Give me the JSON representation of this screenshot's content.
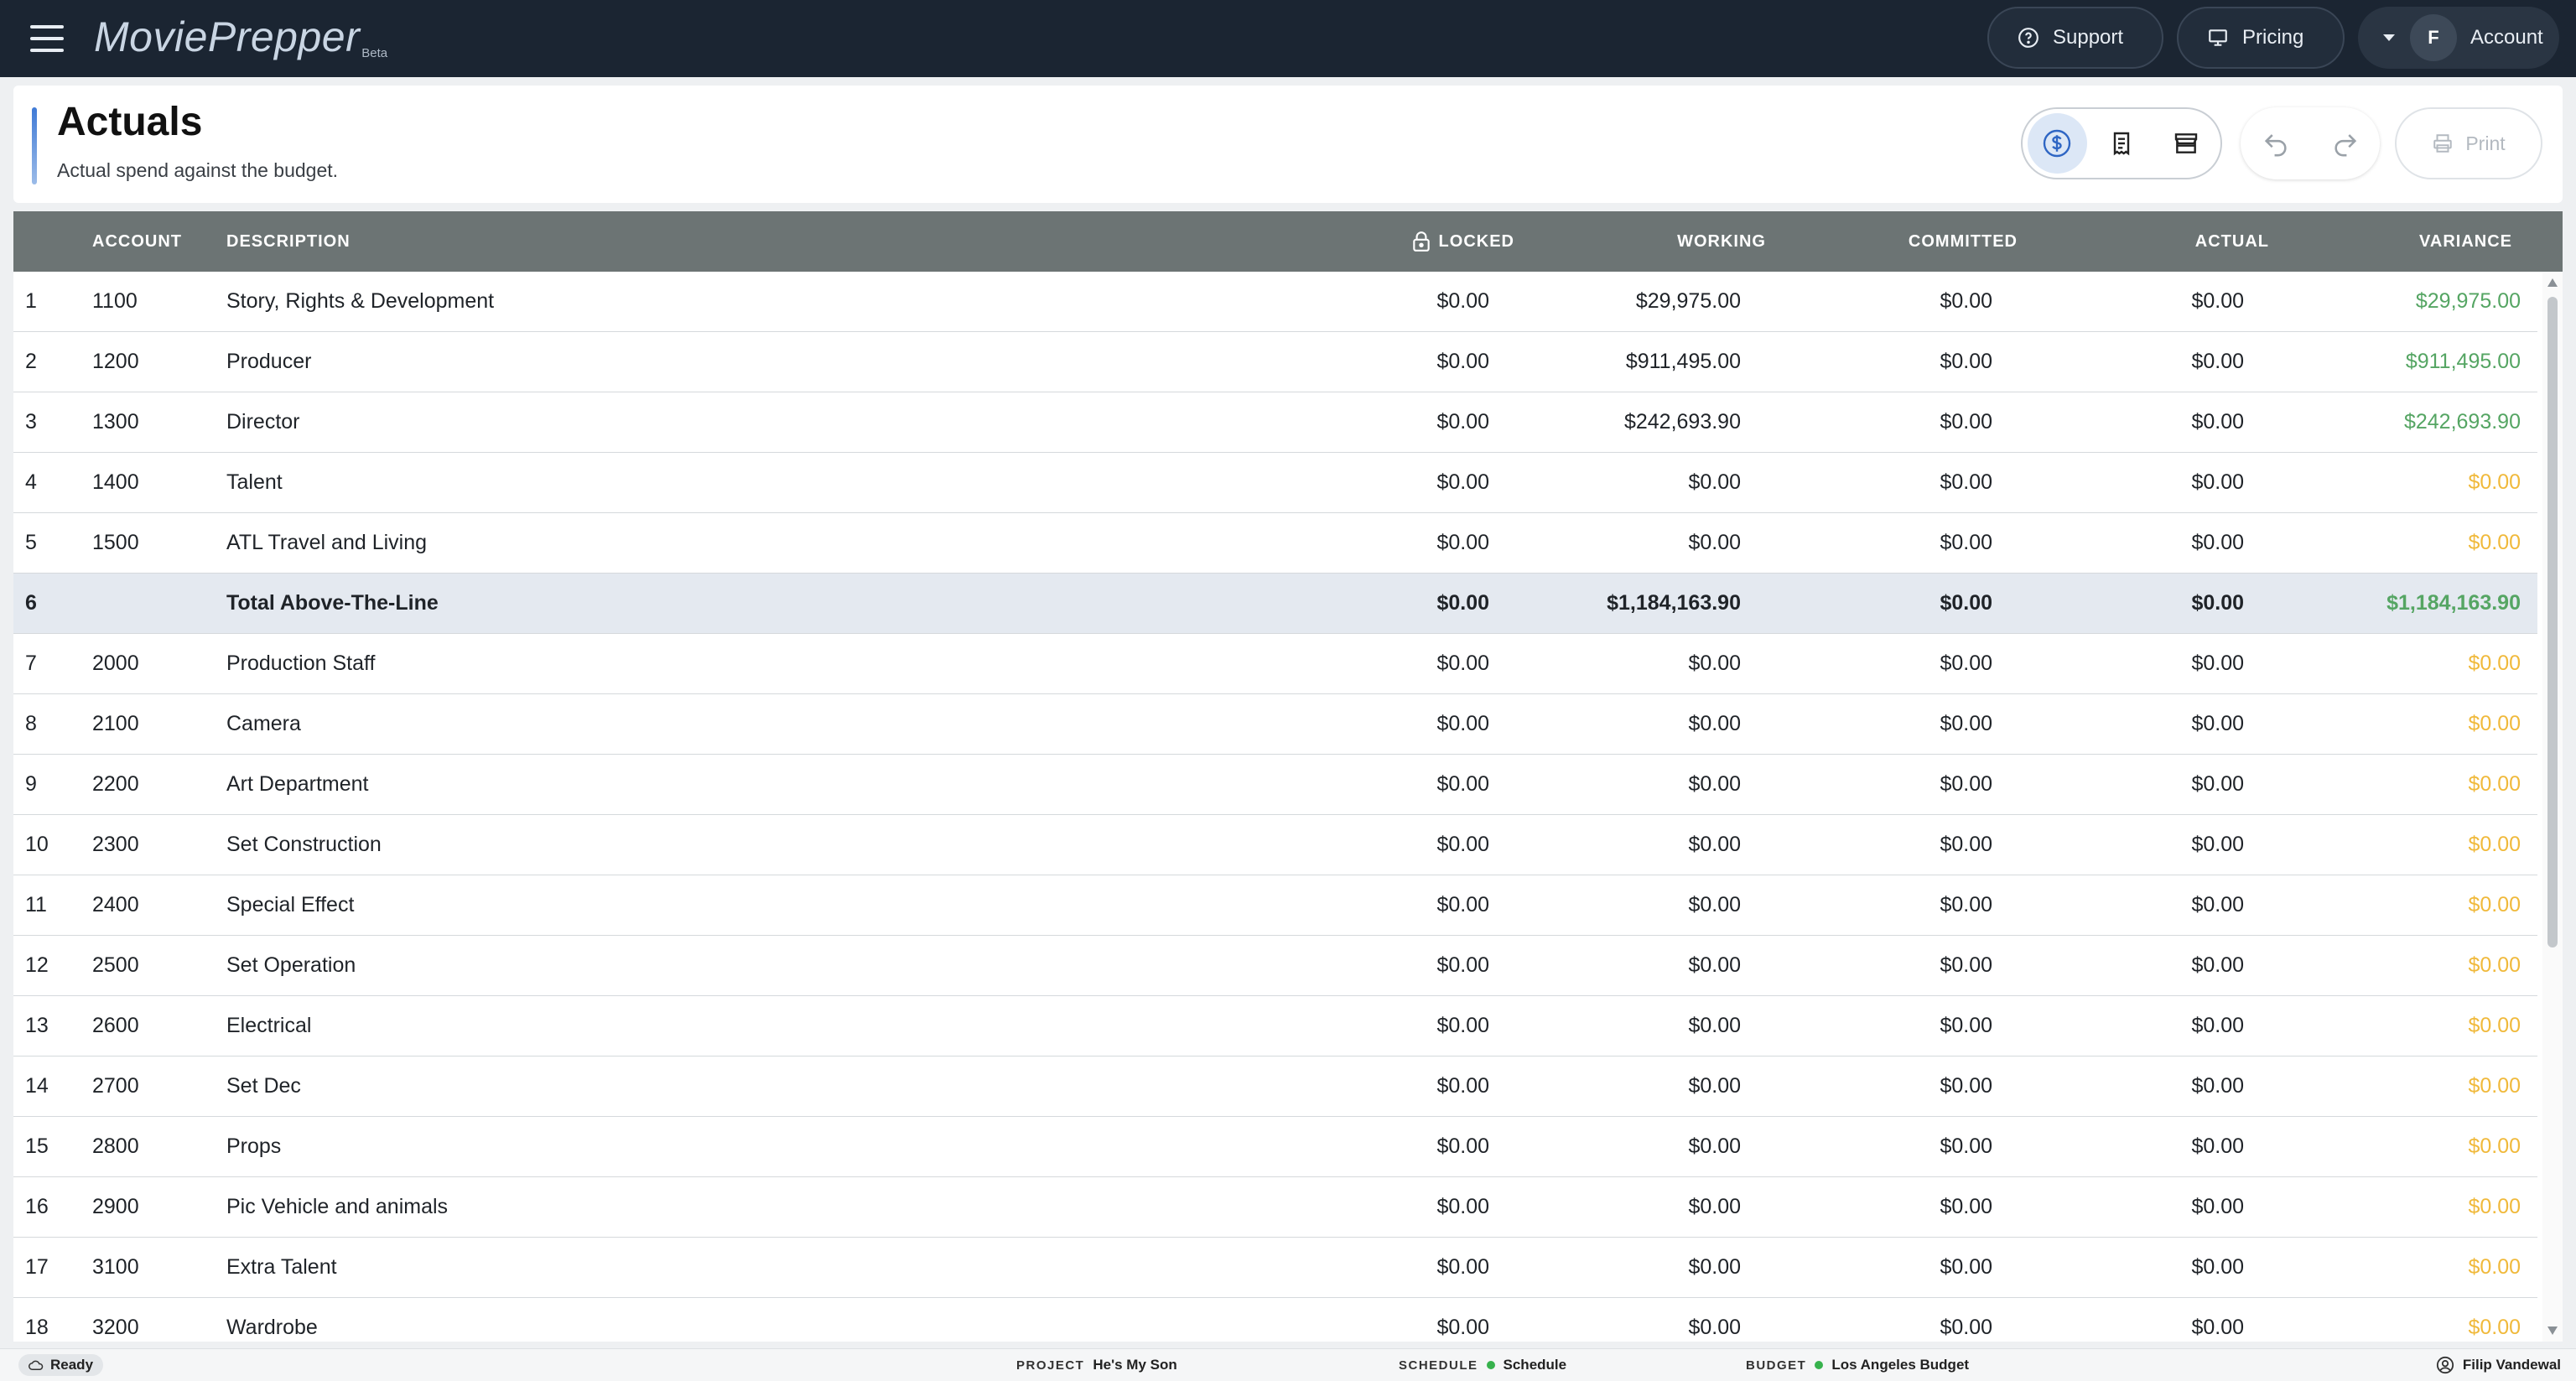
{
  "topbar": {
    "logo_text": "MoviePrepper",
    "logo_badge": "Beta",
    "support_label": "Support",
    "pricing_label": "Pricing",
    "account_initial": "F",
    "account_label": "Account"
  },
  "header": {
    "title": "Actuals",
    "subtitle": "Actual spend against the budget.",
    "print_label": "Print",
    "active_view": "dollar-icon"
  },
  "table": {
    "columns": {
      "account": "ACCOUNT",
      "description": "DESCRIPTION",
      "locked": "LOCKED",
      "working": "WORKING",
      "committed": "COMMITTED",
      "actual": "ACTUAL",
      "variance": "VARIANCE"
    },
    "rows": [
      {
        "num": "1",
        "account": "1100",
        "description": "Story, Rights & Development",
        "locked": "$0.00",
        "working": "$29,975.00",
        "committed": "$0.00",
        "actual": "$0.00",
        "variance": "$29,975.00",
        "variance_state": "positive"
      },
      {
        "num": "2",
        "account": "1200",
        "description": "Producer",
        "locked": "$0.00",
        "working": "$911,495.00",
        "committed": "$0.00",
        "actual": "$0.00",
        "variance": "$911,495.00",
        "variance_state": "positive"
      },
      {
        "num": "3",
        "account": "1300",
        "description": "Director",
        "locked": "$0.00",
        "working": "$242,693.90",
        "committed": "$0.00",
        "actual": "$0.00",
        "variance": "$242,693.90",
        "variance_state": "positive"
      },
      {
        "num": "4",
        "account": "1400",
        "description": "Talent",
        "locked": "$0.00",
        "working": "$0.00",
        "committed": "$0.00",
        "actual": "$0.00",
        "variance": "$0.00",
        "variance_state": "zero"
      },
      {
        "num": "5",
        "account": "1500",
        "description": "ATL Travel and Living",
        "locked": "$0.00",
        "working": "$0.00",
        "committed": "$0.00",
        "actual": "$0.00",
        "variance": "$0.00",
        "variance_state": "zero"
      },
      {
        "num": "6",
        "account": "",
        "description": "Total Above-The-Line",
        "locked": "$0.00",
        "working": "$1,184,163.90",
        "committed": "$0.00",
        "actual": "$0.00",
        "variance": "$1,184,163.90",
        "variance_state": "positive",
        "is_total": true
      },
      {
        "num": "7",
        "account": "2000",
        "description": "Production Staff",
        "locked": "$0.00",
        "working": "$0.00",
        "committed": "$0.00",
        "actual": "$0.00",
        "variance": "$0.00",
        "variance_state": "zero"
      },
      {
        "num": "8",
        "account": "2100",
        "description": "Camera",
        "locked": "$0.00",
        "working": "$0.00",
        "committed": "$0.00",
        "actual": "$0.00",
        "variance": "$0.00",
        "variance_state": "zero"
      },
      {
        "num": "9",
        "account": "2200",
        "description": "Art Department",
        "locked": "$0.00",
        "working": "$0.00",
        "committed": "$0.00",
        "actual": "$0.00",
        "variance": "$0.00",
        "variance_state": "zero"
      },
      {
        "num": "10",
        "account": "2300",
        "description": "Set Construction",
        "locked": "$0.00",
        "working": "$0.00",
        "committed": "$0.00",
        "actual": "$0.00",
        "variance": "$0.00",
        "variance_state": "zero"
      },
      {
        "num": "11",
        "account": "2400",
        "description": "Special Effect",
        "locked": "$0.00",
        "working": "$0.00",
        "committed": "$0.00",
        "actual": "$0.00",
        "variance": "$0.00",
        "variance_state": "zero"
      },
      {
        "num": "12",
        "account": "2500",
        "description": "Set Operation",
        "locked": "$0.00",
        "working": "$0.00",
        "committed": "$0.00",
        "actual": "$0.00",
        "variance": "$0.00",
        "variance_state": "zero"
      },
      {
        "num": "13",
        "account": "2600",
        "description": "Electrical",
        "locked": "$0.00",
        "working": "$0.00",
        "committed": "$0.00",
        "actual": "$0.00",
        "variance": "$0.00",
        "variance_state": "zero"
      },
      {
        "num": "14",
        "account": "2700",
        "description": "Set Dec",
        "locked": "$0.00",
        "working": "$0.00",
        "committed": "$0.00",
        "actual": "$0.00",
        "variance": "$0.00",
        "variance_state": "zero"
      },
      {
        "num": "15",
        "account": "2800",
        "description": "Props",
        "locked": "$0.00",
        "working": "$0.00",
        "committed": "$0.00",
        "actual": "$0.00",
        "variance": "$0.00",
        "variance_state": "zero"
      },
      {
        "num": "16",
        "account": "2900",
        "description": "Pic Vehicle and animals",
        "locked": "$0.00",
        "working": "$0.00",
        "committed": "$0.00",
        "actual": "$0.00",
        "variance": "$0.00",
        "variance_state": "zero"
      },
      {
        "num": "17",
        "account": "3100",
        "description": "Extra Talent",
        "locked": "$0.00",
        "working": "$0.00",
        "committed": "$0.00",
        "actual": "$0.00",
        "variance": "$0.00",
        "variance_state": "zero"
      },
      {
        "num": "18",
        "account": "3200",
        "description": "Wardrobe",
        "locked": "$0.00",
        "working": "$0.00",
        "committed": "$0.00",
        "actual": "$0.00",
        "variance": "$0.00",
        "variance_state": "zero"
      }
    ]
  },
  "statusbar": {
    "ready": "Ready",
    "project_label": "PROJECT",
    "project_value": "He's My Son",
    "schedule_label": "SCHEDULE",
    "schedule_value": "Schedule",
    "budget_label": "BUDGET",
    "budget_value": "Los Angeles Budget",
    "user": "Filip Vandewal"
  },
  "colors": {
    "topbar": "#1b2532",
    "table_header": "#6c7474",
    "variance_positive": "#55a563",
    "variance_zero": "#f0b93b",
    "total_row": "#e4e9f0",
    "status_dot": "#37b24d"
  }
}
